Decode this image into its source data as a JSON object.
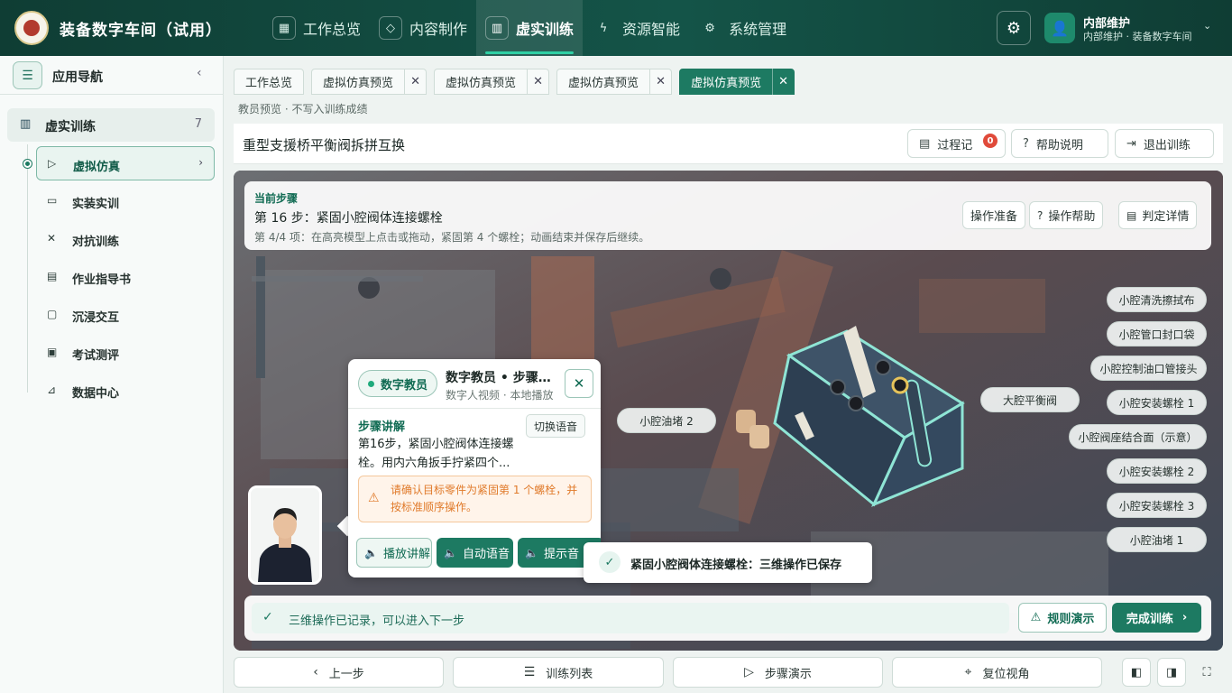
{
  "app": {
    "title": "装备数字车间（试用）"
  },
  "nav": [
    {
      "label": "工作总览",
      "icon": "grid-icon"
    },
    {
      "label": "内容制作",
      "icon": "cube-icon"
    },
    {
      "label": "虚实训练",
      "icon": "book-icon"
    },
    {
      "label": "资源智能",
      "icon": "bolt-icon"
    },
    {
      "label": "系统管理",
      "icon": "gear-icon"
    }
  ],
  "user": {
    "name": "内部维护",
    "subtitle": "内部维护 · 装备数字车间"
  },
  "sidebar": {
    "title": "应用导航",
    "group": {
      "label": "虚实训练",
      "count": "7"
    },
    "items": [
      {
        "label": "虚拟仿真",
        "icon": "play-circle-icon"
      },
      {
        "label": "实装实训",
        "icon": "monitor-icon"
      },
      {
        "label": "对抗训练",
        "icon": "person-icon"
      },
      {
        "label": "作业指导书",
        "icon": "document-icon"
      },
      {
        "label": "沉浸交互",
        "icon": "vr-headset-icon"
      },
      {
        "label": "考试测评",
        "icon": "clipboard-icon"
      },
      {
        "label": "数据中心",
        "icon": "chart-icon"
      }
    ]
  },
  "tabs": [
    {
      "label": "工作总览"
    },
    {
      "label": "虚拟仿真预览"
    },
    {
      "label": "虚拟仿真预览"
    },
    {
      "label": "虚拟仿真预览"
    },
    {
      "label": "虚拟仿真预览"
    }
  ],
  "subnote": "教员预览 · 不写入训练成绩",
  "page": {
    "title": "重型支援桥平衡阀拆拼互换",
    "buttons": {
      "process": "过程记",
      "process_badge": "0",
      "help": "帮助说明",
      "exit": "退出训练"
    }
  },
  "step": {
    "kicker": "当前步骤",
    "title": "第 16 步：紧固小腔阀体连接螺栓",
    "desc": "第 4/4 项：在高亮模型上点击或拖动，紧固第 4 个螺栓；动画结束并保存后继续。",
    "buttons": {
      "prepare": "操作准备",
      "help": "操作帮助",
      "judge": "判定详情"
    }
  },
  "parts": {
    "left": "小腔油堵 2",
    "center": "大腔平衡阀",
    "right": [
      "小腔清洗擦拭布",
      "小腔管口封口袋",
      "小腔控制油口管接头",
      "小腔安装螺栓 1",
      "小腔阀座结合面（示意）",
      "小腔安装螺栓 2",
      "小腔安装螺栓 3",
      "小腔油堵 1"
    ]
  },
  "teacher": {
    "pill": "数字教员",
    "name": "数字教员 • 步骤讲解",
    "sub": "数字人视频 · 本地播放",
    "section": "步骤讲解",
    "switch": "切换语音",
    "text": "第16步，紧固小腔阀体连接螺栓。用内六角扳手拧紧四个...",
    "warn": "请确认目标零件为紧固第 1 个螺栓，并按标准顺序操作。",
    "actions": {
      "play": "播放讲解",
      "auto": "自动语音",
      "hint": "提示音"
    }
  },
  "toast": "紧固小腔阀体连接螺栓：三维操作已保存",
  "status": {
    "text": "三维操作已记录，可以进入下一步",
    "rule": "规则演示",
    "finish": "完成训练"
  },
  "toolbar": {
    "prev": "上一步",
    "list": "训练列表",
    "demo": "步骤演示",
    "reset": "复位视角"
  },
  "colors": {
    "primary": "#1d7a62",
    "header": "#0f3d34",
    "warning": "#e07a2a",
    "badge": "#e04a3a"
  }
}
